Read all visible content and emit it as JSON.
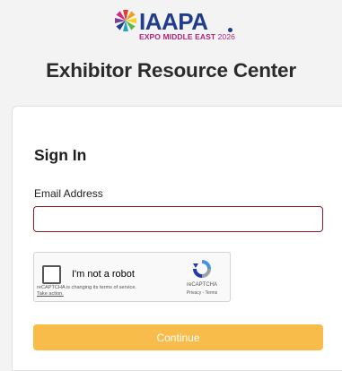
{
  "header": {
    "logo": {
      "icon": "iaapa-pinwheel-icon",
      "wordmark": "IAAPA",
      "subtitle_event": "EXPO MIDDLE EAST",
      "subtitle_year": "2026",
      "wordmark_color": "#1f3c8f",
      "subtitle_color": "#b2267d"
    },
    "title": "Exhibitor Resource Center"
  },
  "signin": {
    "title": "Sign In",
    "email_label": "Email Address",
    "email_value": "",
    "email_border_color": "#8c1a2a"
  },
  "recaptcha": {
    "checkbox_label": "I'm not a robot",
    "notice": "reCAPTCHA is changing its terms of service.",
    "notice_link": "Take action.",
    "brand": "reCAPTCHA",
    "privacy_terms": "Privacy - Terms",
    "icon": "recaptcha-logo-icon"
  },
  "continue": {
    "label": "Continue",
    "color": "#f8bc4a"
  }
}
